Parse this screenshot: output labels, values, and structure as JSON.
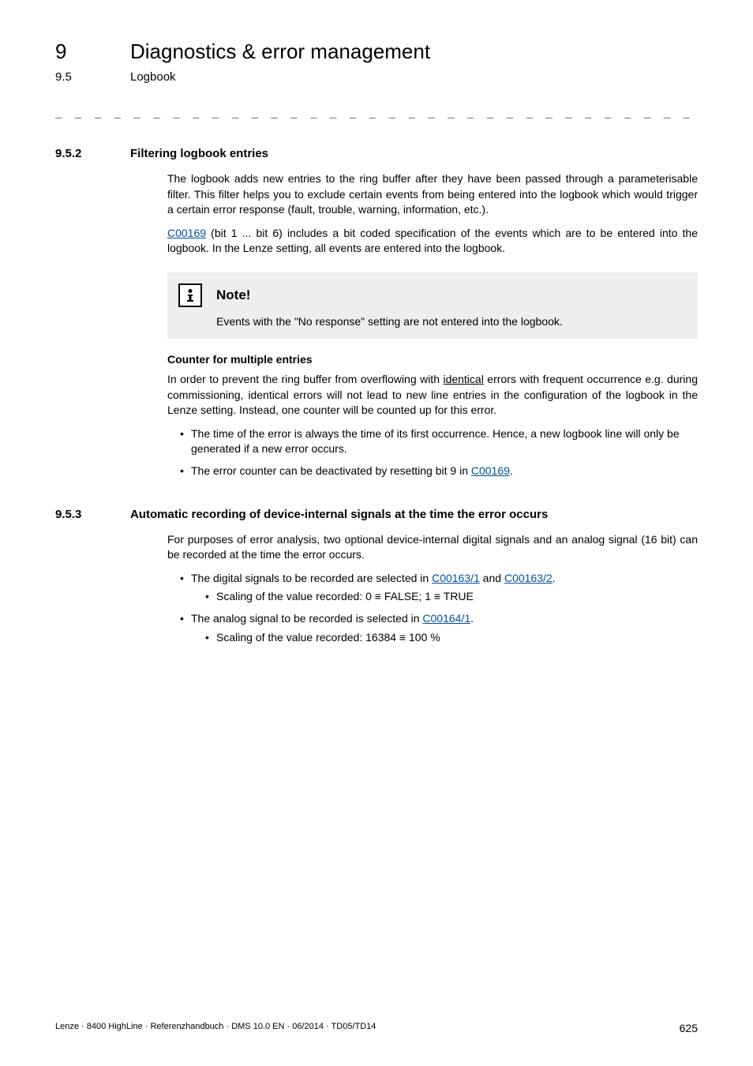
{
  "chapter": {
    "num": "9",
    "title": "Diagnostics & error management"
  },
  "sub": {
    "num": "9.5",
    "title": "Logbook"
  },
  "dashes": "_ _ _ _ _ _ _ _ _ _ _ _ _ _ _ _ _ _ _ _ _ _ _ _ _ _ _ _ _ _ _ _ _ _ _ _ _ _ _ _ _ _ _ _ _ _ _ _ _ _ _ _ _ _ _ _ _ _ _ _ _ _ _ _",
  "sec1": {
    "num": "9.5.2",
    "title": "Filtering logbook entries",
    "p1": "The logbook adds new entries to the ring buffer after they have been passed through a parameterisable filter. This filter helps you to exclude certain events from being entered into the logbook which would trigger a certain error response (fault, trouble, warning, information, etc.).",
    "p2_link": "C00169",
    "p2_rest": " (bit 1 ... bit 6) includes a bit coded specification of the events which are to be entered into the logbook. In the Lenze setting, all events are entered into the logbook."
  },
  "note": {
    "title": "Note!",
    "body": "Events with the \"No response\" setting are not entered into the logbook."
  },
  "counter": {
    "heading": "Counter for multiple entries",
    "p_pre": "In order to prevent the ring buffer from overflowing with ",
    "p_underlined": "identical",
    "p_post": " errors with frequent occurrence e.g. during commissioning, identical errors will not lead to new line entries in the configuration of the logbook in the Lenze setting. Instead, one counter will be counted up for this error.",
    "b1": "The time of the error is always the time of its first occurrence. Hence, a new logbook line will only be generated if a new error occurs.",
    "b2_pre": "The error counter can be deactivated by resetting bit 9 in ",
    "b2_link": "C00169",
    "b2_post": "."
  },
  "sec2": {
    "num": "9.5.3",
    "title": "Automatic recording of device-internal signals at the time the error occurs",
    "p1": "For purposes of error analysis, two optional device-internal digital signals and an analog signal (16 bit) can be recorded at the time the error occurs.",
    "b1_pre": "The digital signals to be recorded are selected in ",
    "b1_link1": "C00163/1",
    "b1_mid": " and ",
    "b1_link2": "C00163/2",
    "b1_post": ".",
    "b1_sub": "Scaling of the value recorded: 0 ≡ FALSE; 1 ≡ TRUE",
    "b2_pre": "The analog signal to be recorded is selected in ",
    "b2_link": "C00164/1",
    "b2_post": ".",
    "b2_sub": "Scaling of the value recorded: 16384 ≡ 100 %"
  },
  "footer": {
    "left": "Lenze · 8400 HighLine · Referenzhandbuch · DMS 10.0 EN · 06/2014 · TD05/TD14",
    "right": "625"
  }
}
